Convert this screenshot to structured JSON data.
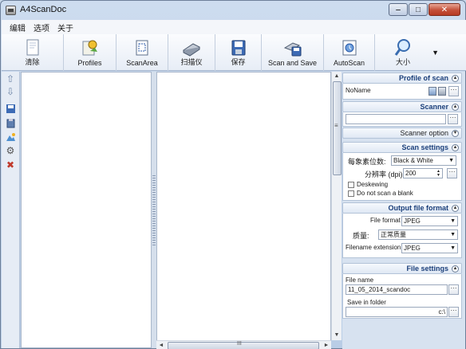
{
  "window": {
    "title": "A4ScanDoc"
  },
  "menu": [
    "编辑",
    "选项",
    "关于"
  ],
  "toolbar": [
    {
      "label": "清除",
      "icon": "clear-document-icon"
    },
    {
      "label": "Profiles",
      "icon": "profiles-icon"
    },
    {
      "label": "ScanArea",
      "icon": "scan-area-icon"
    },
    {
      "label": "扫描仪",
      "icon": "scanner-icon"
    },
    {
      "label": "保存",
      "icon": "save-icon"
    },
    {
      "label": "Scan and Save",
      "icon": "scan-and-save-icon"
    },
    {
      "label": "AutoScan",
      "icon": "autoscan-icon"
    },
    {
      "label": "大小",
      "icon": "zoom-icon"
    }
  ],
  "left_tools": [
    "move-up-icon",
    "move-down-icon",
    "save-page-icon",
    "clipboard-icon",
    "image-icon",
    "settings-icon",
    "delete-icon"
  ],
  "panel": {
    "profile": {
      "header": "Profile of scan",
      "value": "NoName"
    },
    "scanner": {
      "header": "Scanner",
      "value": "",
      "option_label": "Scanner option"
    },
    "scan_settings": {
      "header": "Scan settings",
      "bpp_label": "每象素位数:",
      "bpp_value": "Black & White",
      "dpi_label": "分辨率 (dpi):",
      "dpi_value": "200",
      "deskew_label": "Deskewing",
      "blank_label": "Do not scan a blank"
    },
    "output": {
      "header": "Output file format",
      "format_label": "File format",
      "format_value": "JPEG",
      "quality_label": "质量:",
      "quality_value": "正常质量",
      "ext_label": "Filename extension:",
      "ext_value": "JPEG"
    },
    "file": {
      "header": "File settings",
      "name_label": "File name",
      "name_value": "11_05_2014_scandoc",
      "folder_label": "Save in  folder",
      "folder_value": "c:\\"
    }
  },
  "colors": {
    "accent": "#1b3f7a",
    "frame": "#c9d8ea"
  }
}
